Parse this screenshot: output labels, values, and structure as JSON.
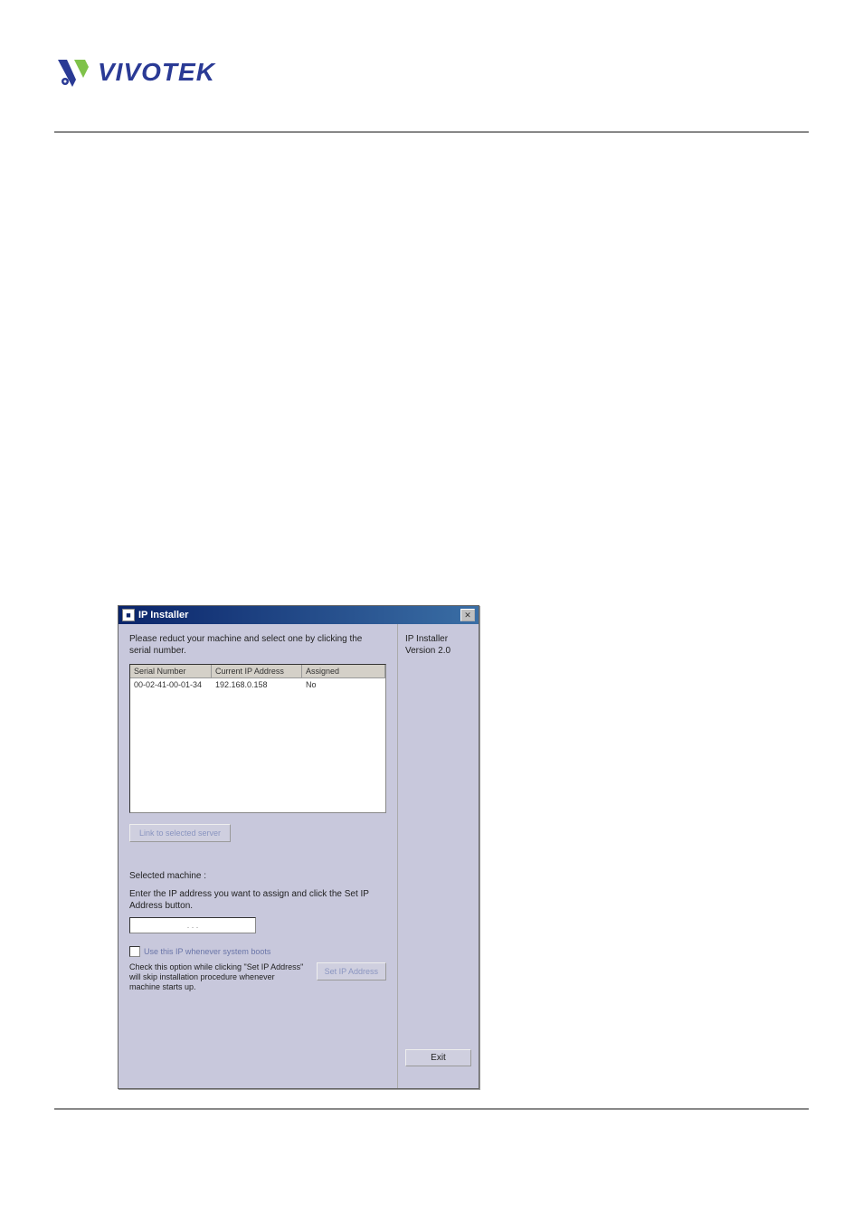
{
  "logo": {
    "brand_text": "VIVOTEK"
  },
  "installer": {
    "window_title": "IP Installer",
    "instruction": "Please reduct your machine and select one by clicking the serial number.",
    "columns": {
      "serial": "Serial Number",
      "ip": "Current IP Address",
      "assigned": "Assigned"
    },
    "row": {
      "serial": "00-02-41-00-01-34",
      "ip": "192.168.0.158",
      "assigned": "No"
    },
    "link_button": "Link to selected server",
    "selected_label": "Selected machine :",
    "enter_ip_label": "Enter the IP address you want to assign and click the Set IP Address button.",
    "ip_dots": ". . .",
    "checkbox_label": "Use this IP whenever system boots",
    "help_text": "Check this option while clicking \"Set IP Address\" will skip installation procedure whenever machine starts up.",
    "set_ip_button": "Set IP Address",
    "app_name": "IP Installer",
    "version": "Version 2.0",
    "exit_button": "Exit"
  },
  "footer": {
    "link_placeholder": ""
  }
}
